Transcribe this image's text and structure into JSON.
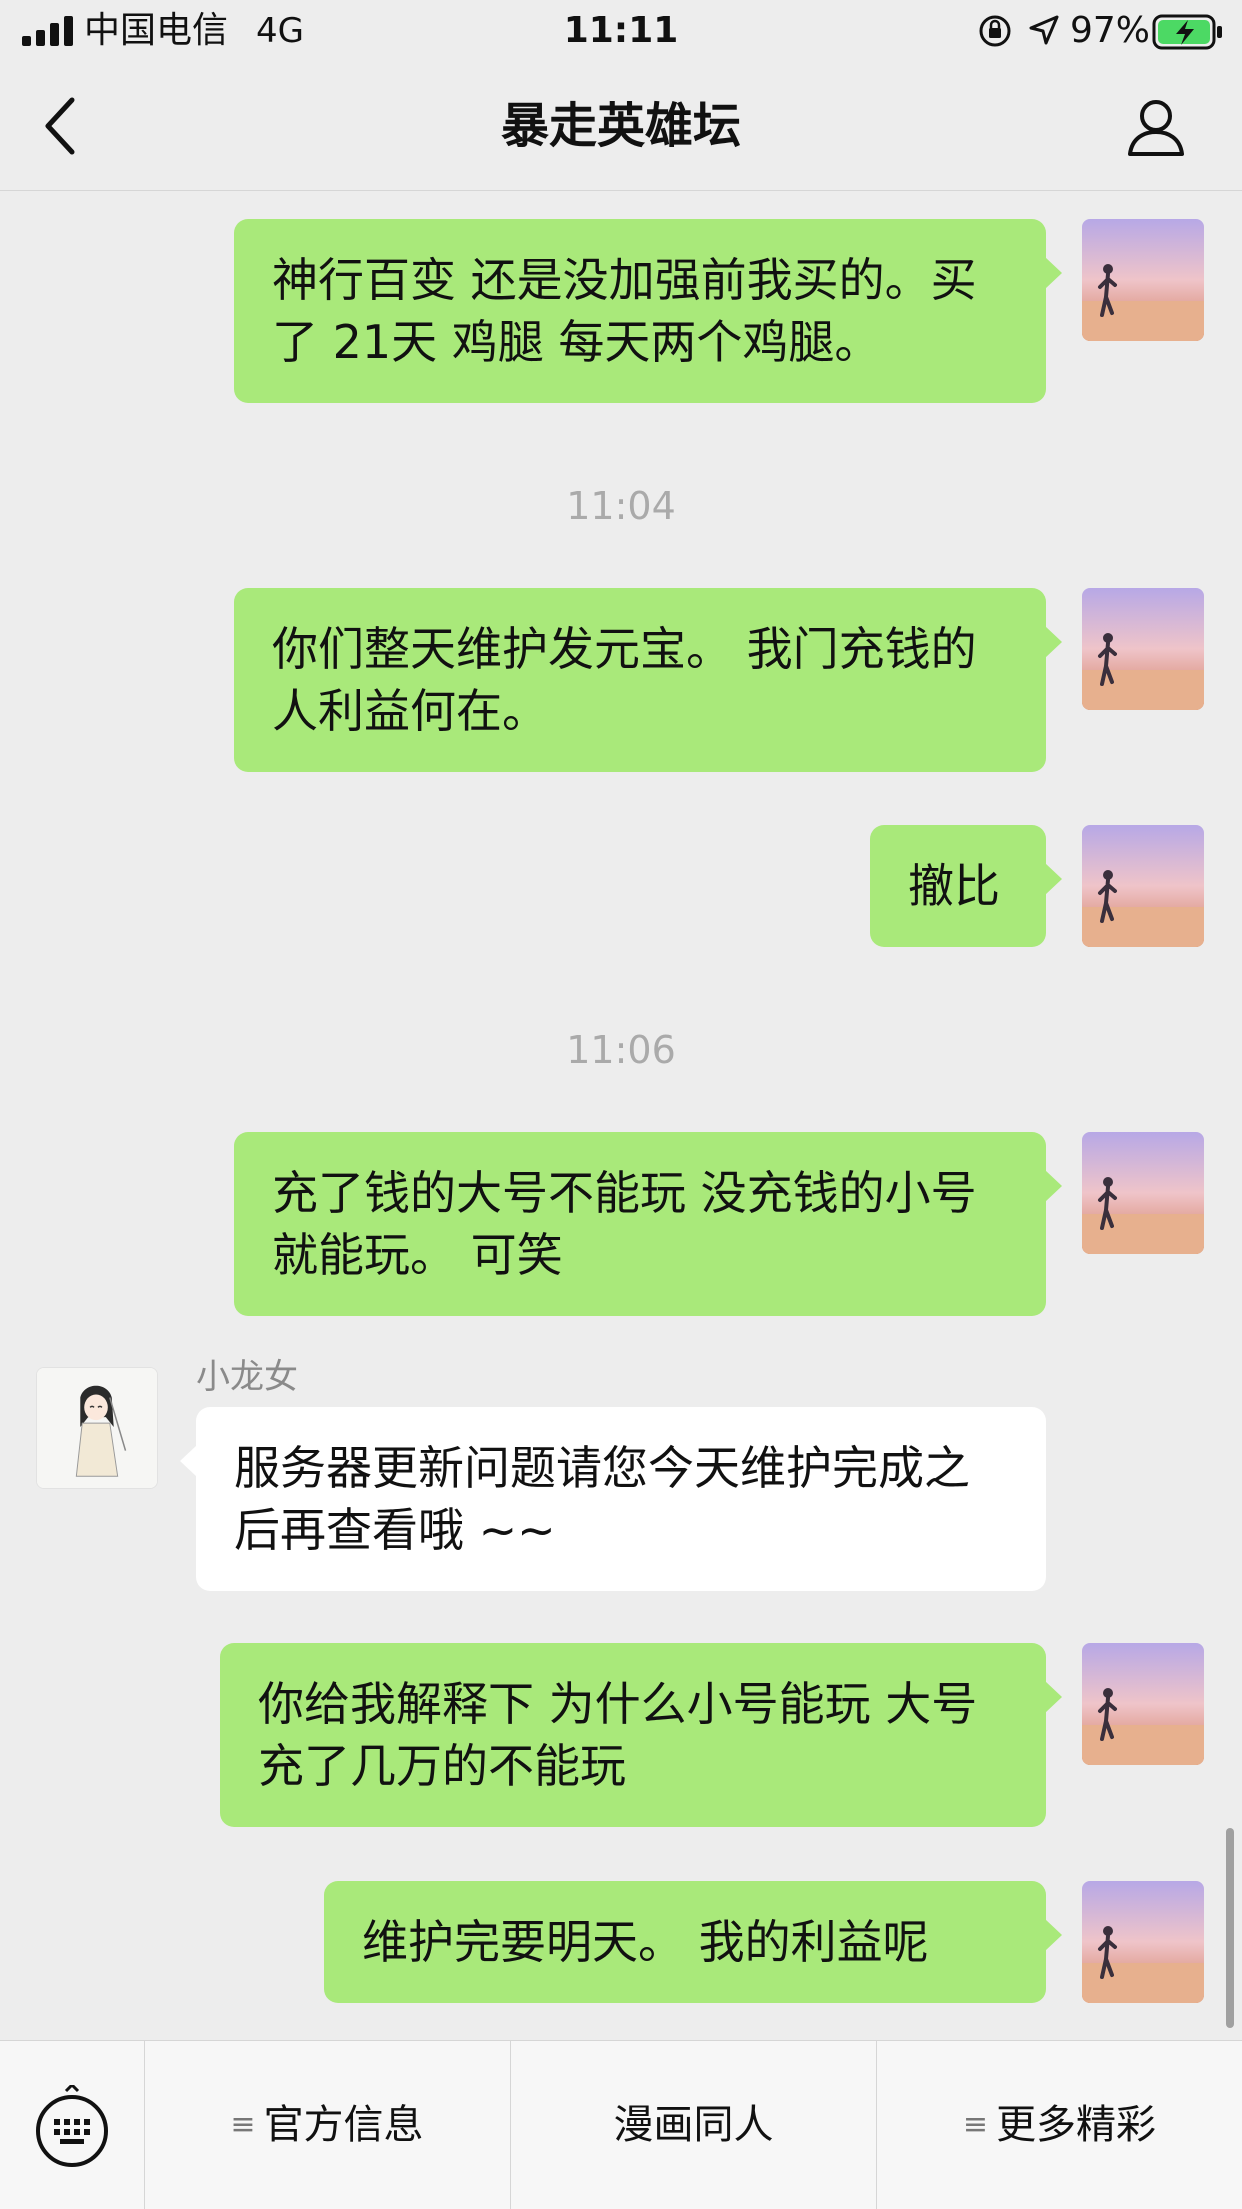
{
  "status_bar": {
    "carrier": "中国电信",
    "network": "4G",
    "time": "11:11",
    "battery_percent": "97%",
    "icons": [
      "signal-icon",
      "orientation-lock-icon",
      "location-arrow-icon",
      "battery-charging-icon"
    ]
  },
  "nav": {
    "title": "暴走英雄坛",
    "back_icon": "chevron-left-icon",
    "profile_icon": "person-outline-icon"
  },
  "colors": {
    "background": "#ededed",
    "my_bubble": "#a9e97a",
    "their_bubble": "#ffffff",
    "timestamp": "#aaaaaa"
  },
  "messages": [
    {
      "from": "me",
      "text": " 神行百变 还是没加强前我买的。买了 21天 鸡腿 每天两个鸡腿。"
    },
    {
      "timestamp": "11:04"
    },
    {
      "from": "me",
      "text": "你们整天维护发元宝。 我门充钱的人利益何在。"
    },
    {
      "from": "me",
      "text": "撤比"
    },
    {
      "timestamp": "11:06"
    },
    {
      "from": "me",
      "text": "充了钱的大号不能玩 没充钱的小号就能玩。 可笑"
    },
    {
      "from": "them",
      "sender": "小龙女",
      "text": "服务器更新问题请您今天维护完成之后再查看哦 ~~"
    },
    {
      "from": "me",
      "text": "你给我解释下 为什么小号能玩 大号充了几万的不能玩"
    },
    {
      "from": "me",
      "text": "维护完要明天。 我的利益呢"
    }
  ],
  "bottom_menu": {
    "keyboard_icon": "keyboard-icon",
    "tabs": [
      {
        "label": "官方信息",
        "has_submenu": true
      },
      {
        "label": "漫画同人",
        "has_submenu": false
      },
      {
        "label": "更多精彩",
        "has_submenu": true
      }
    ],
    "submenu_glyph": "≡"
  }
}
